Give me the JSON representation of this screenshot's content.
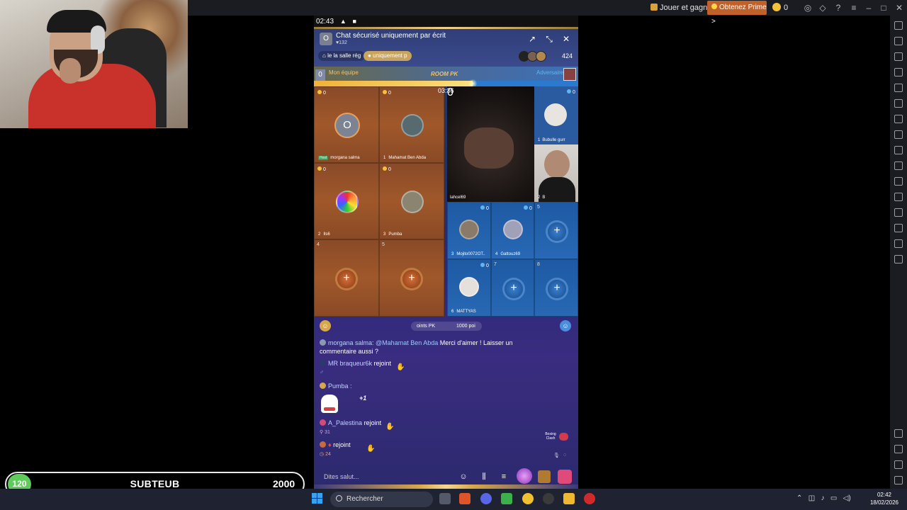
{
  "emulator": {
    "play_earn": "Jouer et gagner",
    "prime_button": "Obtenez Prime >",
    "coins": "0"
  },
  "phone": {
    "status_time": "02:43",
    "room": {
      "avatar_letter": "O",
      "title": "Chat sécurisé uniquement par écrit",
      "likes": "132",
      "chip_room": "le la salle rég",
      "chip_private": "uniquement p",
      "viewer_count": "424"
    },
    "pk": {
      "left_score": "0",
      "my_team": "Mon équipe",
      "logo": "ROOM PK",
      "opponent": "Adversaire",
      "timer": "03:36",
      "progress_fraction": 0.6,
      "points_label": "oints PK",
      "points_value": "1000 poi"
    },
    "my_seats": [
      {
        "score": "0",
        "name": "morgana salma",
        "host_tag": "Host",
        "num": ""
      },
      {
        "score": "0",
        "name": "Mahamat Ben Abda",
        "num": "1"
      },
      {
        "score": "0",
        "name": "Ils6",
        "num": "2"
      },
      {
        "score": "0",
        "name": "Pumba",
        "num": "3"
      },
      {
        "num": "4"
      },
      {
        "num": "5"
      }
    ],
    "opp_seats": {
      "big_name": "lahcel69",
      "side_a": {
        "score": "0",
        "num": "1",
        "name": "Bubulle gurr"
      },
      "side_b": {
        "num": "2",
        "name": "B"
      },
      "big_score": "0",
      "row2": [
        {
          "num": "3",
          "name": "Mojito0072OT..",
          "score": "0"
        },
        {
          "num": "4",
          "name": "Gattouz69",
          "score": "0"
        },
        {
          "num": "5"
        }
      ],
      "row3": [
        {
          "num": "6",
          "name": "MATTYAS",
          "score": "0"
        },
        {
          "num": "7"
        },
        {
          "num": "8"
        }
      ]
    },
    "chat": {
      "m1_user": "morgana salma:",
      "m1_mention": "@Mahamat Ben Abda",
      "m1_text": "Merci d'aimer ! Laisser un",
      "m1_text2": "commentaire aussi ?",
      "m2_user": "MR braqueur6k",
      "m2_action": "rejoint",
      "m3_user": "Pumba :",
      "m3_plus": "+1",
      "m4_user": "A_Palestina",
      "m4_action": "rejoint",
      "m4_level": "31",
      "m5_action": "rejoint",
      "m5_level": "24"
    },
    "boxing_badge": "Boxing Clash",
    "input_placeholder": "Dites salut..."
  },
  "sub_goal": {
    "current": "120",
    "label": "SUBTEUB",
    "goal": "2000"
  },
  "taskbar": {
    "search_label": "Rechercher",
    "time": "02:42",
    "date": "18/02/2026"
  },
  "colors": {
    "my_team": "#a0582a",
    "opponent_team": "#2868b4",
    "prime": "#c0612a",
    "sub_current": "#5fcb5a"
  }
}
